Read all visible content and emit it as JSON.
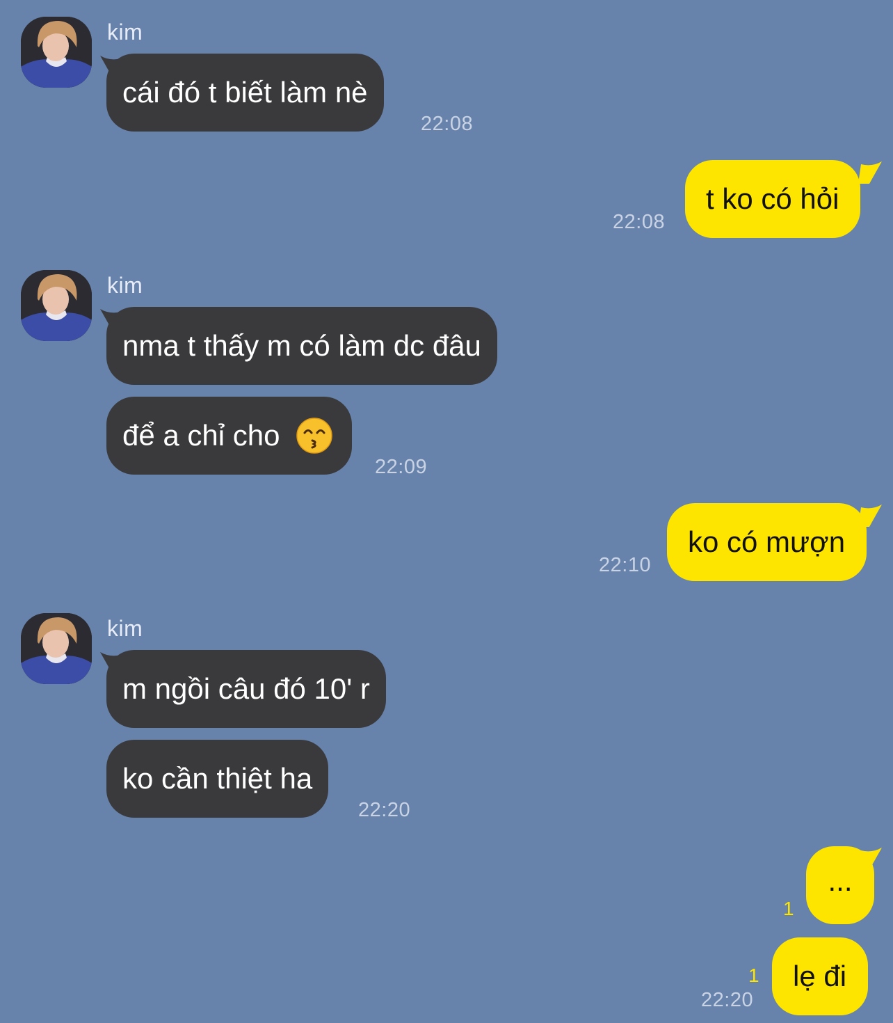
{
  "sender_name": "kim",
  "groups": [
    {
      "messages": [
        "cái đó t biết làm nè"
      ],
      "time": "22:08"
    },
    {
      "messages": [
        "nma t thấy m có làm dc đâu",
        "để a chỉ cho"
      ],
      "emoji": "kissing-face-smiling-eyes-icon",
      "time": "22:09"
    },
    {
      "messages": [
        "m ngồi câu đó 10' r",
        "ko cần thiệt ha"
      ],
      "time": "22:20"
    }
  ],
  "outgoing": [
    {
      "text": "t ko có hỏi",
      "time": "22:08"
    },
    {
      "text": "ko có mượn",
      "time": "22:10"
    },
    {
      "text": "...",
      "unread": "1"
    },
    {
      "text": "lẹ đi",
      "unread": "1",
      "time": "22:20"
    }
  ],
  "colors": {
    "background": "#6783ab",
    "incoming_bubble": "#3a3a3d",
    "outgoing_bubble": "#fee500",
    "timestamp": "#c9d3e4",
    "unread_count": "#fee500"
  }
}
